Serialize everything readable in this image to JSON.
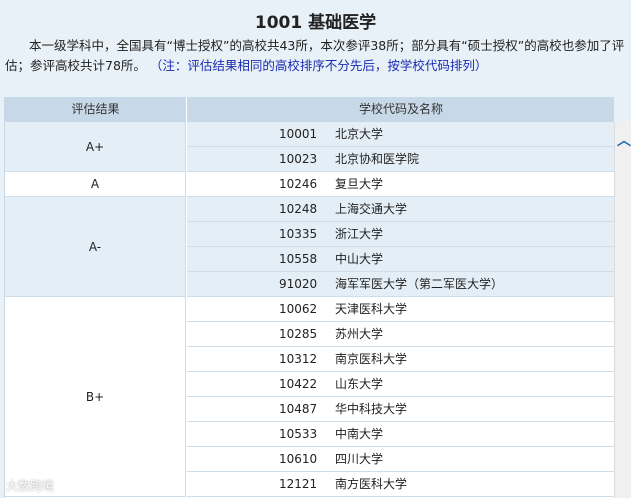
{
  "title": "1001 基础医学",
  "intro": {
    "text": "本一级学科中，全国具有“博士授权”的高校共43所，本次参评38所；部分具有“硕士授权”的高校也参加了评估；参评高校共计78所。",
    "note": "（注：评估结果相同的高校排序不分先后，按学校代码排列）"
  },
  "table": {
    "col_grade": "评估结果",
    "col_school": "学校代码及名称",
    "groups": [
      {
        "grade": "A+",
        "rows": [
          {
            "code": "10001",
            "name": "北京大学"
          },
          {
            "code": "10023",
            "name": "北京协和医学院"
          }
        ]
      },
      {
        "grade": "A",
        "rows": [
          {
            "code": "10246",
            "name": "复旦大学"
          }
        ]
      },
      {
        "grade": "A-",
        "rows": [
          {
            "code": "10248",
            "name": "上海交通大学"
          },
          {
            "code": "10335",
            "name": "浙江大学"
          },
          {
            "code": "10558",
            "name": "中山大学"
          },
          {
            "code": "91020",
            "name": "海军军医大学（第二军医大学）"
          }
        ]
      },
      {
        "grade": "B+",
        "rows": [
          {
            "code": "10062",
            "name": "天津医科大学"
          },
          {
            "code": "10285",
            "name": "苏州大学"
          },
          {
            "code": "10312",
            "name": "南京医科大学"
          },
          {
            "code": "10422",
            "name": "山东大学"
          },
          {
            "code": "10487",
            "name": "华中科技大学"
          },
          {
            "code": "10533",
            "name": "中南大学"
          },
          {
            "code": "10610",
            "name": "四川大学"
          },
          {
            "code": "12121",
            "name": "南方医科大学"
          }
        ]
      }
    ]
  },
  "watermark": "大数跨境",
  "icons": {
    "scroll_up": "chevron-up-icon"
  }
}
